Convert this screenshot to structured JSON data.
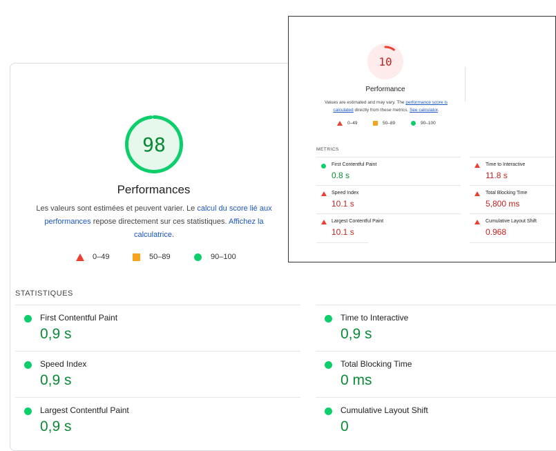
{
  "main": {
    "score": "98",
    "score_fraction": 0.98,
    "title": "Performances",
    "description": {
      "part1": "Les valeurs sont estimées et peuvent varier. Le ",
      "link1": "calcul du score lié aux performances",
      "part2": " repose directement sur ces statistiques. ",
      "link2": "Affichez la calculatrice",
      "part3": "."
    },
    "legend": [
      "0–49",
      "50–89",
      "90–100"
    ],
    "metrics_label": "STATISTIQUES",
    "metrics": [
      {
        "label": "First Contentful Paint",
        "value": "0,9 s",
        "status": "good"
      },
      {
        "label": "Time to Interactive",
        "value": "0,9 s",
        "status": "good"
      },
      {
        "label": "Speed Index",
        "value": "0,9 s",
        "status": "good"
      },
      {
        "label": "Total Blocking Time",
        "value": "0 ms",
        "status": "good"
      },
      {
        "label": "Largest Contentful Paint",
        "value": "0,9 s",
        "status": "good"
      },
      {
        "label": "Cumulative Layout Shift",
        "value": "0",
        "status": "good"
      }
    ]
  },
  "inset": {
    "score": "10",
    "score_fraction": 0.1,
    "title": "Performance",
    "description": {
      "part1": "Values are estimated and may vary. The ",
      "link1": "performance score is calculated",
      "part2": " directly from these metrics. ",
      "link2": "See calculator",
      "part3": "."
    },
    "legend": [
      "0–49",
      "50–89",
      "90–100"
    ],
    "metrics_label": "METRICS",
    "metrics": [
      {
        "label": "First Contentful Paint",
        "value": "0.8 s",
        "status": "good"
      },
      {
        "label": "Time to Interactive",
        "value": "11.8 s",
        "status": "poor"
      },
      {
        "label": "Speed Index",
        "value": "10.1 s",
        "status": "poor"
      },
      {
        "label": "Total Blocking Time",
        "value": "5,800 ms",
        "status": "poor"
      },
      {
        "label": "Largest Contentful Paint",
        "value": "10.1 s",
        "status": "poor"
      },
      {
        "label": "Cumulative Layout Shift",
        "value": "0.968",
        "status": "poor"
      }
    ]
  },
  "colors": {
    "good": "#0cce6b",
    "average": "#f4a51d",
    "poor": "#eb3f31",
    "link": "#1a56c6"
  }
}
